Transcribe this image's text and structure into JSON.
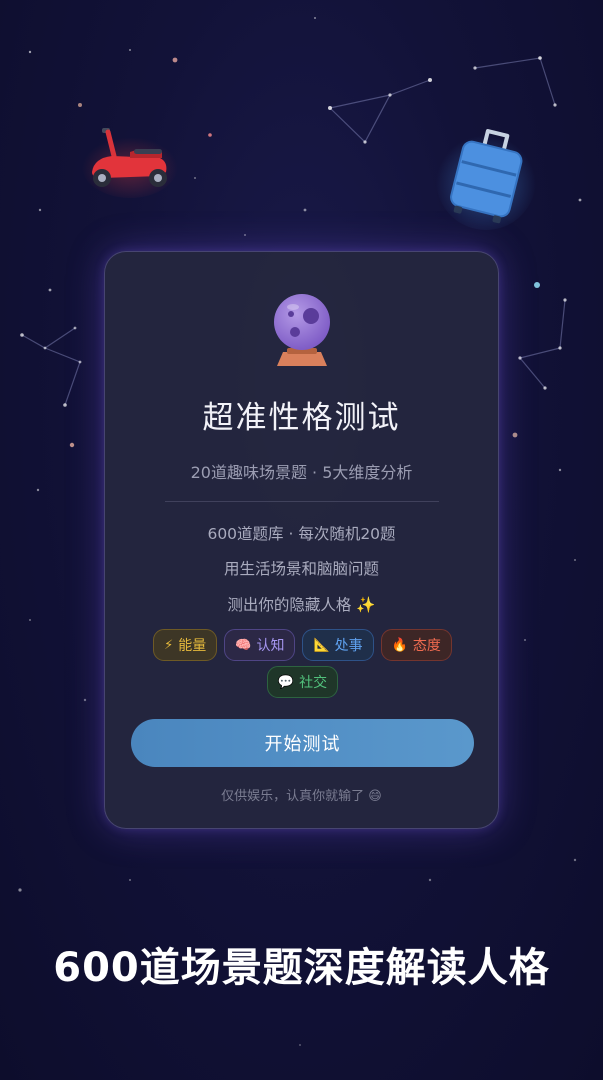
{
  "card": {
    "title": "超准性格测试",
    "subtitle": "20道趣味场景题 · 5大维度分析",
    "description": [
      "600道题库 · 每次随机20题",
      "用生活场景和脑脑问题",
      "测出你的隐藏人格"
    ],
    "sparkle": "✨",
    "tags": [
      {
        "icon": "⚡",
        "icon_name": "lightning-icon",
        "label": "能量",
        "color": "#e5b93c"
      },
      {
        "icon": "🧠",
        "icon_name": "brain-icon",
        "label": "认知",
        "color": "#a596f0"
      },
      {
        "icon": "📐",
        "icon_name": "triangle-ruler-icon",
        "label": "处事",
        "color": "#5ea0ee"
      },
      {
        "icon": "🔥",
        "icon_name": "fire-icon",
        "label": "态度",
        "color": "#ef6b50"
      },
      {
        "icon": "💬",
        "icon_name": "speech-bubble-icon",
        "label": "社交",
        "color": "#52c27c"
      }
    ],
    "start_button": "开始测试",
    "disclaimer": "仅供娱乐，认真你就输了",
    "disclaimer_emoji": "😄"
  },
  "caption": "600道场景题深度解读人格",
  "colors": {
    "background": "#121238",
    "card": "#24263e",
    "accent_button": "#5090c6"
  }
}
